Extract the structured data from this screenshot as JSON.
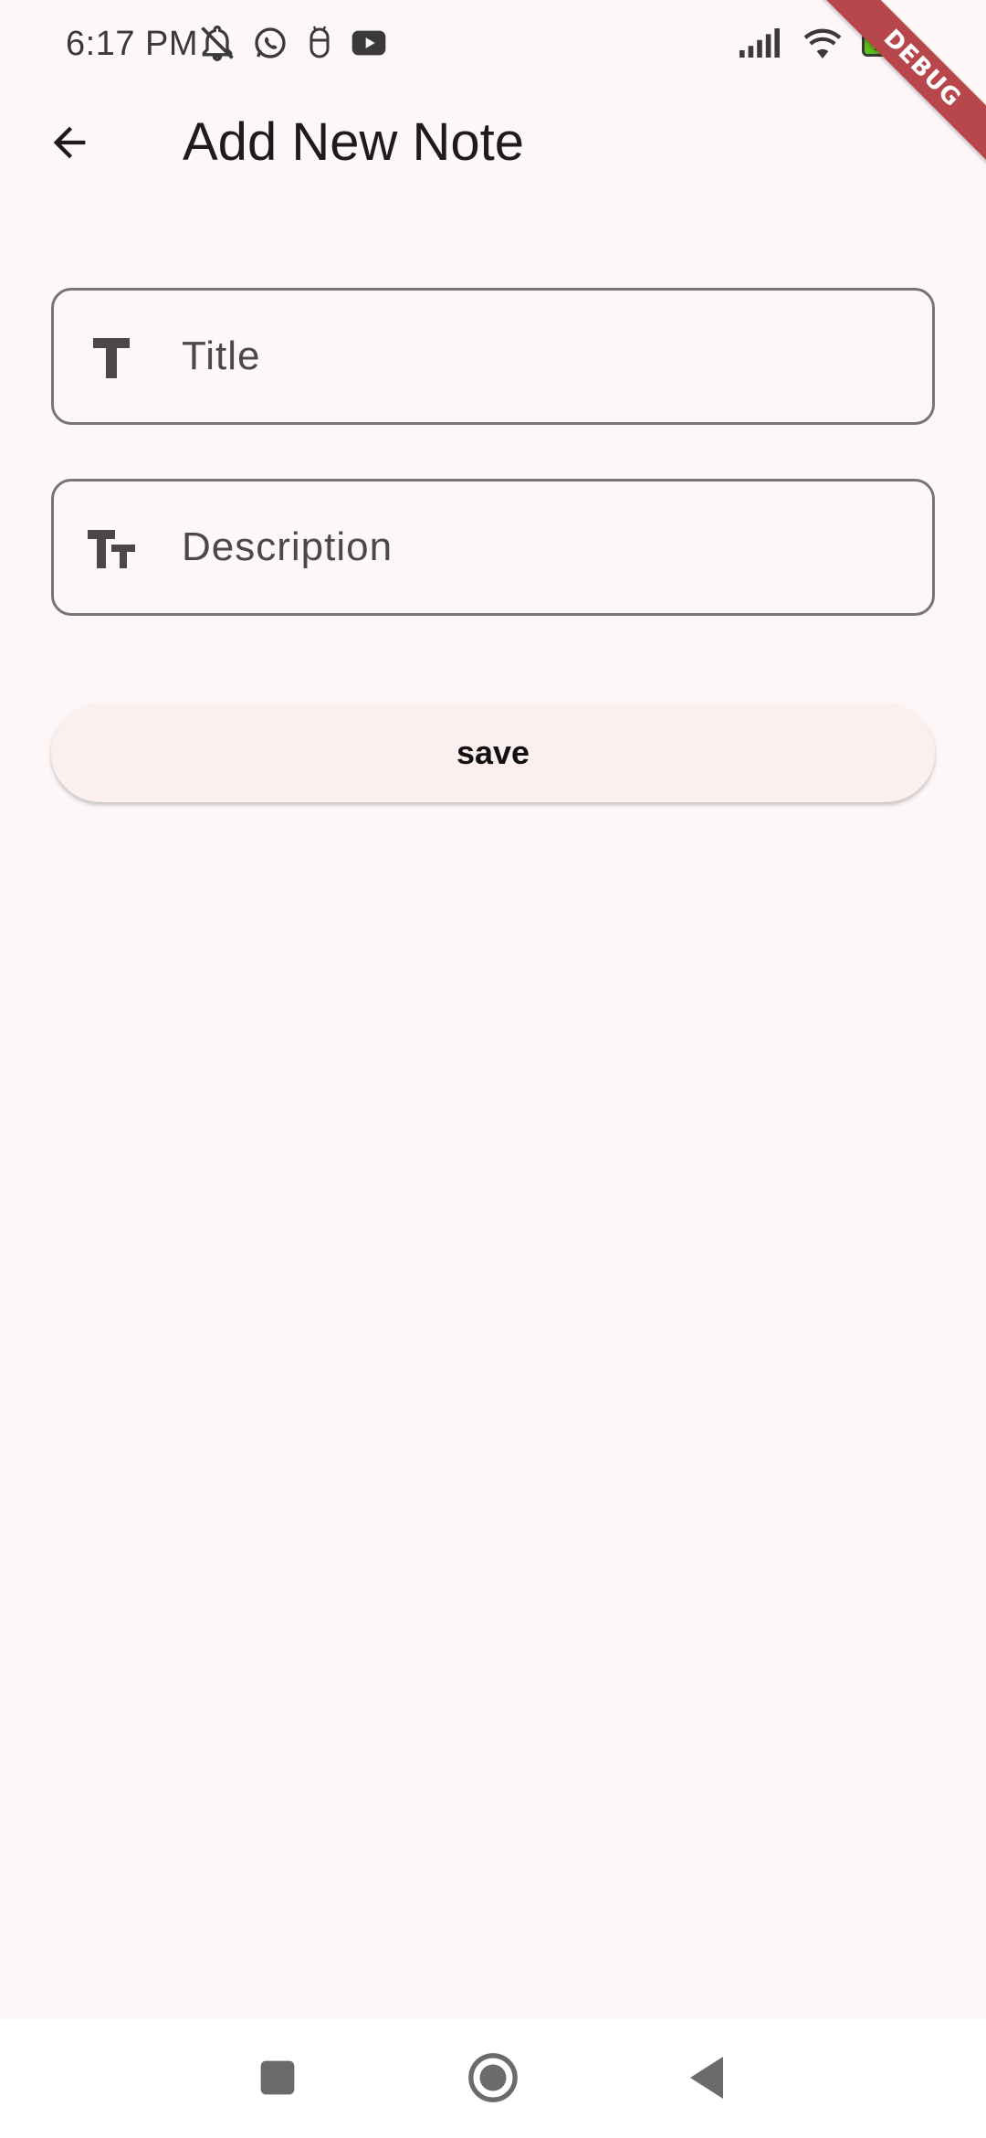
{
  "status_bar": {
    "time": "6:17 PM",
    "battery_level": "100",
    "left_icons": [
      "notifications-muted-icon",
      "whatsapp-icon",
      "notification-app-icon",
      "youtube-icon"
    ],
    "right_icons": [
      "cellular-signal-icon",
      "wifi-icon",
      "battery-icon"
    ]
  },
  "debug_banner": "DEBUG",
  "app_bar": {
    "title": "Add New Note",
    "back_icon": "arrow-back-icon"
  },
  "form": {
    "title_field": {
      "placeholder": "Title",
      "value": "",
      "icon": "title-icon"
    },
    "description_field": {
      "placeholder": "Description",
      "value": "",
      "icon": "text-fields-icon"
    },
    "save_label": "save"
  },
  "nav_bar": {
    "buttons": [
      "recents-icon",
      "home-icon",
      "back-icon"
    ]
  },
  "colors": {
    "background": "#fdf7f7",
    "field_border": "#7a7477",
    "button_background": "#fcefef",
    "debug_ribbon": "#b8474b",
    "battery_fill": "#5dc21e"
  }
}
